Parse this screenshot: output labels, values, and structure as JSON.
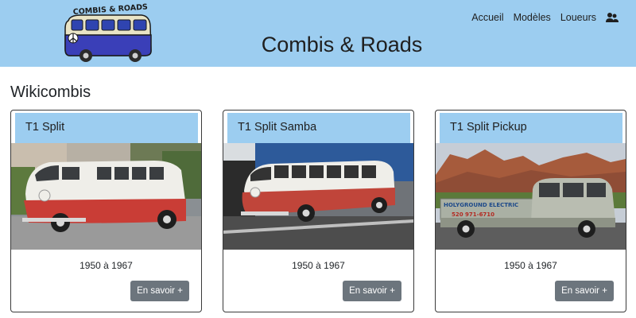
{
  "header": {
    "site_title": "Combis & Roads",
    "logo_text": "COMBIS & ROADS",
    "nav": [
      {
        "label": "Accueil"
      },
      {
        "label": "Modèles"
      },
      {
        "label": "Loueurs"
      }
    ],
    "user_icon": "users-icon"
  },
  "page": {
    "heading": "Wikicombis"
  },
  "cards": [
    {
      "title": "T1 Split",
      "years": "1950 à 1967",
      "button": "En savoir +",
      "image": "red-white-vw-bus-photo"
    },
    {
      "title": "T1 Split Samba",
      "years": "1950 à 1967",
      "button": "En savoir +",
      "image": "red-white-samba-bus-photo"
    },
    {
      "title": "T1 Split Pickup",
      "years": "1950 à 1967",
      "button": "En savoir +",
      "image": "grey-pickup-mountains-photo",
      "image_text": [
        "HOLYGROUND ELECTRIC",
        "520 971-6710"
      ]
    }
  ],
  "colors": {
    "header_bg": "#9ccdf0",
    "button_bg": "#6c757d"
  }
}
